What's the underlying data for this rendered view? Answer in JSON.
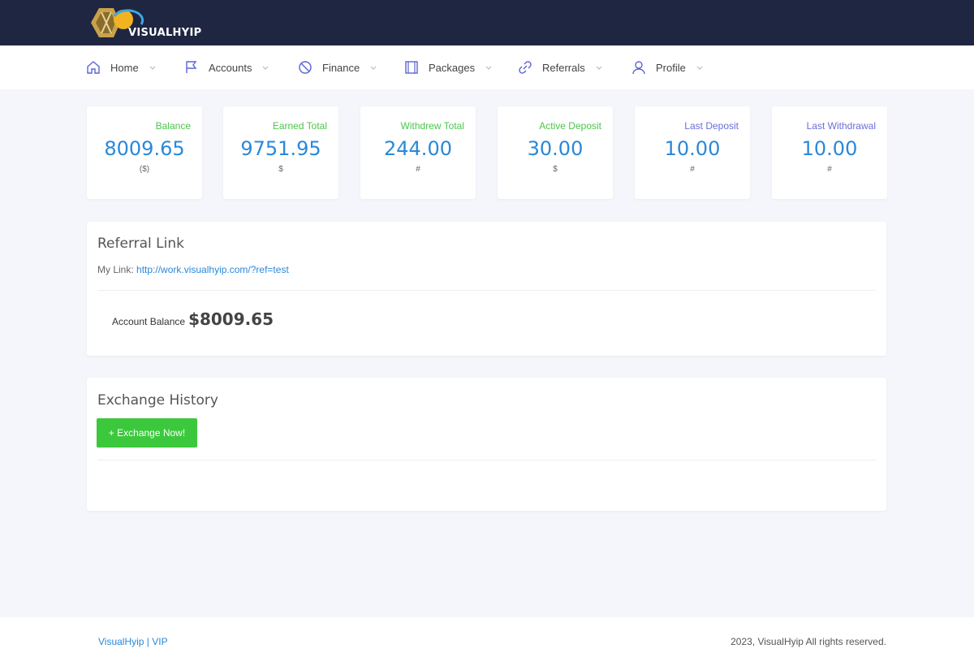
{
  "brand": {
    "name": "VISUALHYIP"
  },
  "nav": {
    "items": [
      {
        "label": "Home",
        "icon": "home-icon"
      },
      {
        "label": "Accounts",
        "icon": "flag-icon"
      },
      {
        "label": "Finance",
        "icon": "finance-icon"
      },
      {
        "label": "Packages",
        "icon": "packages-icon"
      },
      {
        "label": "Referrals",
        "icon": "link-icon"
      },
      {
        "label": "Profile",
        "icon": "user-icon"
      }
    ]
  },
  "stats": [
    {
      "label": "Balance",
      "value": "8009.65",
      "unit": "($)",
      "label_color": "#4cc64c"
    },
    {
      "label": "Earned Total",
      "value": "9751.95",
      "unit": "$",
      "label_color": "#4cc64c"
    },
    {
      "label": "Withdrew Total",
      "value": "244.00",
      "unit": "#",
      "label_color": "#4cc64c"
    },
    {
      "label": "Active Deposit",
      "value": "30.00",
      "unit": "$",
      "label_color": "#4cc64c"
    },
    {
      "label": "Last Deposit",
      "value": "10.00",
      "unit": "#",
      "label_color": "#6a6fd6"
    },
    {
      "label": "Last Withdrawal",
      "value": "10.00",
      "unit": "#",
      "label_color": "#6a6fd6"
    }
  ],
  "referral": {
    "title": "Referral Link",
    "my_link_label": "My Link:",
    "my_link_url": "http://work.visualhyip.com/?ref=test",
    "balance_label": "Account Balance",
    "balance_value": "$8009.65"
  },
  "exchange": {
    "title": "Exchange History",
    "button_label": "+ Exchange Now!"
  },
  "footer": {
    "left_text": "VisualHyip | VIP",
    "right_text": "2023, VisualHyip All rights reserved."
  },
  "colors": {
    "topbar": "#1f2642",
    "accent_blue": "#2a88d8",
    "button_green": "#3cc83c"
  }
}
